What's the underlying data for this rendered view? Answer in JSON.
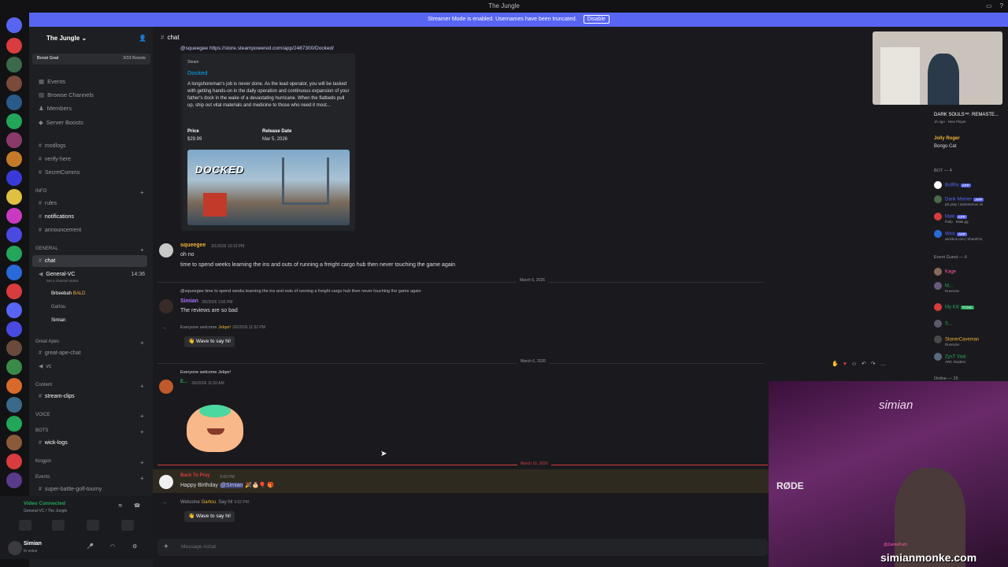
{
  "window": {
    "title": "The Jungle"
  },
  "banner": {
    "text": "Streamer Mode is enabled. Usernames have been truncated.",
    "button": "Disable"
  },
  "guild": {
    "name": "The Jungle",
    "boost_label": "Boost Goal",
    "boost_count": "3/33 Boosts"
  },
  "nav": {
    "events": "Events",
    "browse": "Browse Channels",
    "members": "Members",
    "boosts": "Server Boosts"
  },
  "channels": {
    "modlogs": "modlogs",
    "verify": "verify-here",
    "secret": "SecretComms",
    "cat_info": "INFO",
    "rules": "rules",
    "notifications": "notifications",
    "announcement": "announcement",
    "cat_general": "GENERAL",
    "chat": "chat",
    "general_vc": "General-VC",
    "general_vc_time": "14:36",
    "general_vc_status": "Set a channel status",
    "vc_user1": "Brbeebah",
    "vc_user1_tag": "BALD",
    "vc_user2": "Gartou",
    "vc_user3": "Simian",
    "cat_great_apes": "Great Apes",
    "great_ape_chat": "great-ape-chat",
    "vc": "vc",
    "cat_content": "Content",
    "stream_clips": "stream-clips",
    "cat_voice": "VOICE",
    "cat_bots": "BOTS",
    "wick_logs": "wick-logs",
    "cat_kingpin": "Kingpin",
    "cat_events": "Events",
    "super_battle": "super-battle-golf-tourny"
  },
  "voice": {
    "status": "Video Connected",
    "channel": "General-VC / The Jungle"
  },
  "user": {
    "name": "Simian",
    "status": "In voice"
  },
  "header": {
    "channel": "chat"
  },
  "embed": {
    "link": "@squeegee https://store.steampowered.com/app/2487300/Docked/",
    "provider": "Steam",
    "title": "Docked",
    "description": "A longshoreman's job is never done. As the lead operator, you will be tasked with getting hands-on in the daily operation and continuous expansion of your father's dock in the wake of a devastating hurricane. When the flatbeds pull up, ship out vital materials and medicine to those who need it most...",
    "price_label": "Price",
    "price": "$29.99",
    "release_label": "Release Date",
    "release": "Mar 5, 2026",
    "image_text": "DOCKED"
  },
  "messages": {
    "m1_user": "squeegee",
    "m1_time": "3/1/2026 10:10 PM",
    "m1_line1": "oh no",
    "m1_line2": "time to spend weeks learning the ins and outs of running a freight cargo hub then never touching the game again",
    "div1": "March 5, 2026",
    "m2_reply": "@squeegee time to spend weeks learning the ins and outs of running a freight cargo hub then never touching the game again",
    "m2_user": "Simian",
    "m2_time": "3/5/2026 3:56 PM",
    "m2_text": "The reviews are so bad",
    "m3_welcome": "Everyone welcome",
    "m3_name": "Jelqer!",
    "m3_time": "3/6/2026 11:52 PM",
    "m3_wave": "Wave to say hi!",
    "div2": "March 6, 2026",
    "m4_header": "Everyone welcome Jelqer!",
    "m4_user": "E...",
    "m4_time": "3/6/2026 11:50 AM",
    "div3": "March 16, 2026",
    "m5_user": "Back To Pray",
    "m5_time": "3:43 PM",
    "m5_text": "Happy Birthday",
    "m5_mention": "@Simian",
    "m6_welcome": "Welcome",
    "m6_name": "Gartou",
    "m6_suffix": ". Say hi!",
    "m6_time": "9:52 PM",
    "m6_wave": "Wave to say hi!"
  },
  "composer": {
    "placeholder": "Message #chat"
  },
  "members": {
    "game": "DARK SOULS™: REMASTE...",
    "game_sub": "1h ago · New Player",
    "jolly": "Jolly Roger",
    "jolly_game": "Bongo Cat",
    "bot_header": "BOT — 4",
    "bot1": "BotRix",
    "bot2": "Dank Memer",
    "bot2_sub": "pls play | dankmemer.lol",
    "bot3": "Maki",
    "bot3_sub": "/help · Maki.gg",
    "bot4": "Wick",
    "bot4_sub": "wickbot.com | Shard#11",
    "app_tag": "APP",
    "guest_header": "Event Guest — 6",
    "g1": "Kage",
    "g2": "M...",
    "g2_sub": "RuneLite",
    "g3": "My Kill",
    "g3_tag": "TOXIC",
    "g4": "S...",
    "g5": "StonerCaveman",
    "g5_sub": "RuneLite",
    "g6": "ZysT Vaal",
    "g6_sub": "ARC Raiders",
    "online": "Online — 29"
  },
  "overlay": {
    "cam_text": "simian",
    "brand": "RØDE",
    "watermark": "simianmonke.com",
    "handle": "@ZamisPuch"
  },
  "colors": {
    "accent": "#5865f2",
    "squeegee": "#f0b232",
    "simian": "#a970ff",
    "green": "#23a55a",
    "pink": "#ff5ea8"
  }
}
